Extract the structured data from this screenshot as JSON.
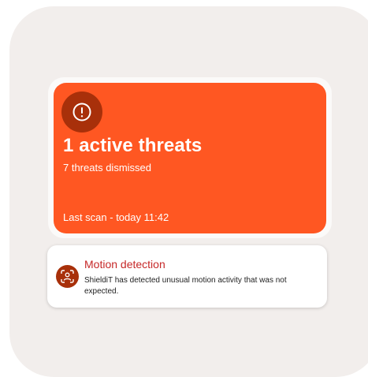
{
  "threat_card": {
    "icon": "alert-exclamation-icon",
    "title": "1 active threats",
    "dismissed": "7 threats dismissed",
    "last_scan": "Last scan - today 11:42"
  },
  "notification": {
    "icon": "face-scan-icon",
    "title": "Motion detection",
    "body": "ShieldiT has detected unusual motion activity that was not expected."
  },
  "colors": {
    "accent": "#ff5722",
    "accent_dark": "#a8300a",
    "notification_title": "#c62828",
    "background": "#f2eeec"
  }
}
